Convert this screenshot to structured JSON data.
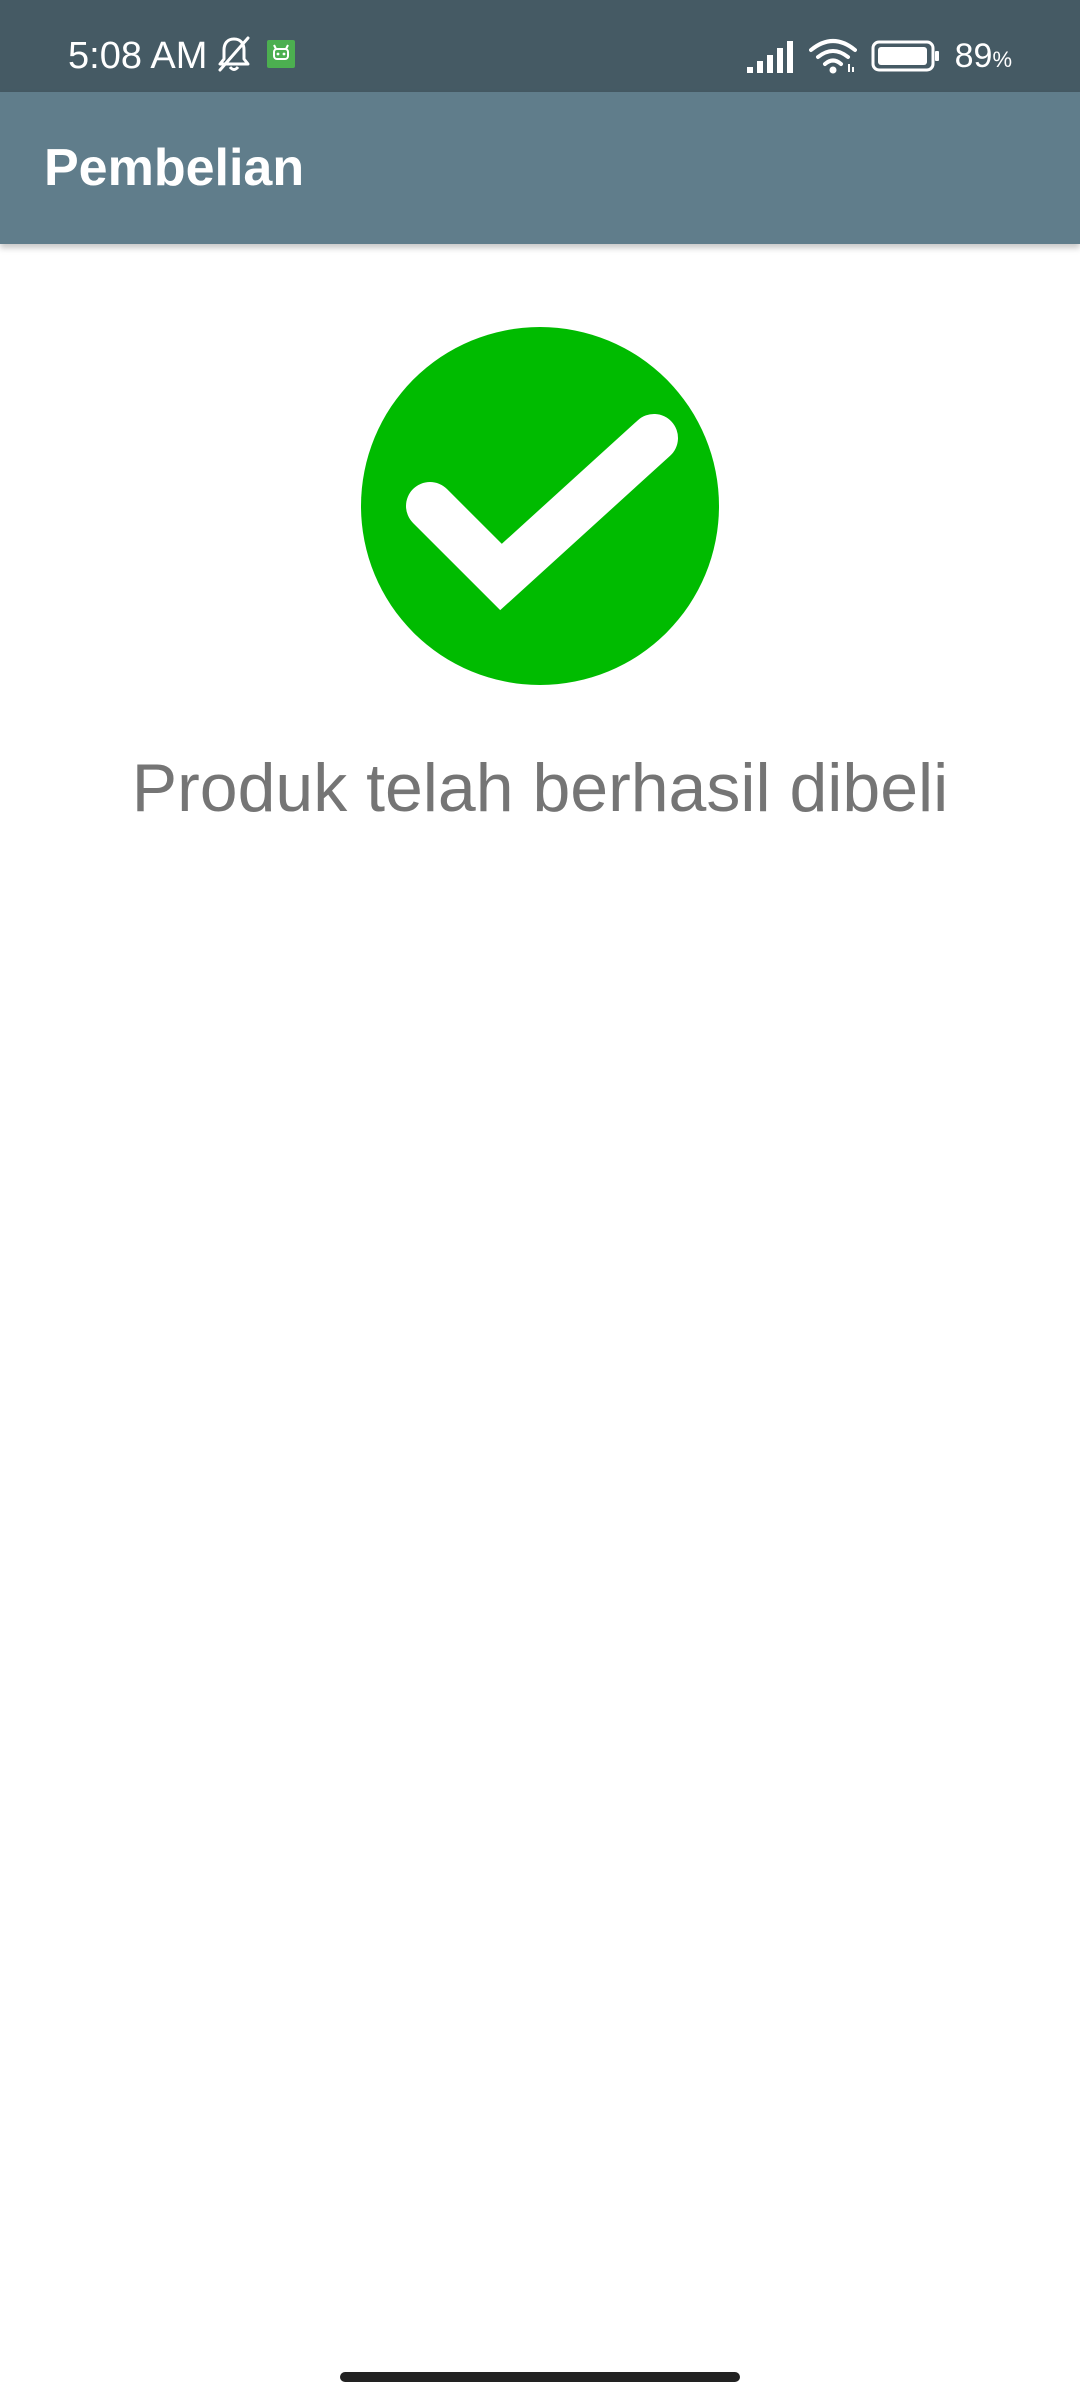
{
  "status_bar": {
    "time": "5:08 AM",
    "battery_level": "89",
    "battery_unit": "%",
    "icons": [
      "bell-off-icon",
      "android-app-icon",
      "signal-icon",
      "wifi-icon",
      "battery-icon"
    ]
  },
  "app_bar": {
    "title": "Pembelian"
  },
  "main": {
    "icon": "checkmark-circle-icon",
    "message": "Produk telah berhasil dibeli"
  },
  "colors": {
    "status_bar": "#455a64",
    "app_bar": "#607d8b",
    "success_green": "#00bb00",
    "message_text": "#757575"
  }
}
